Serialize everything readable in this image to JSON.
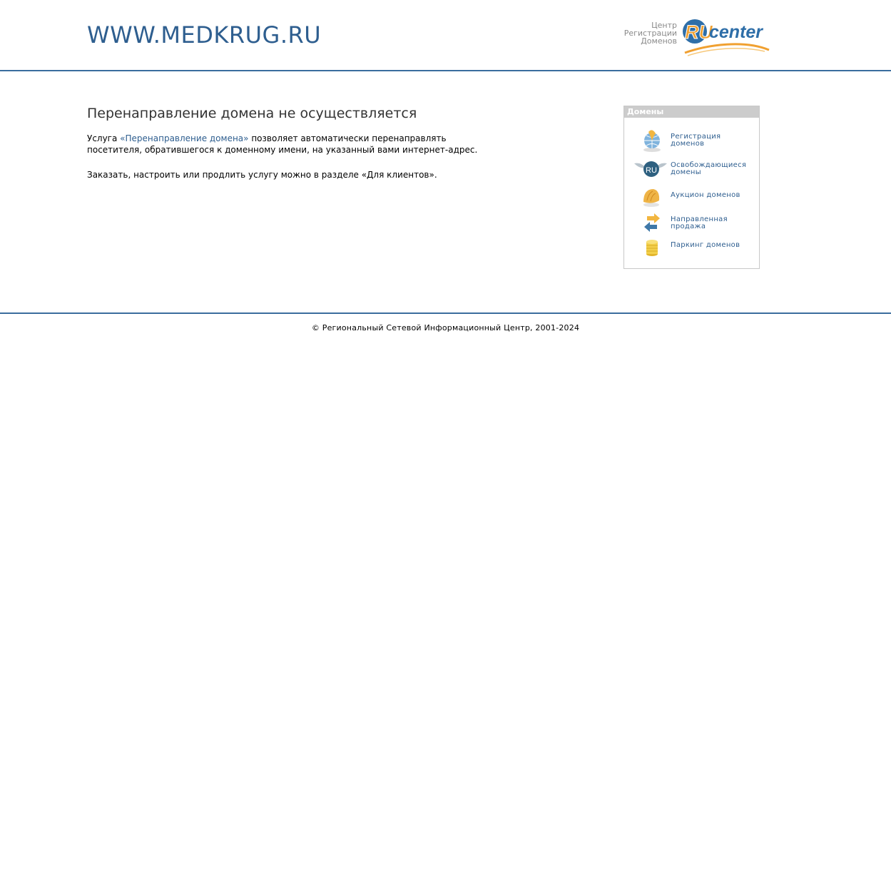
{
  "header": {
    "site_title": "WWW.MEDKRUG.RU",
    "logo_caption": [
      "Центр",
      "Регистрации",
      "Доменов"
    ],
    "logo_mark_ru": "RU",
    "logo_mark_center": "center"
  },
  "main": {
    "heading": "Перенаправление домена не осуществляется",
    "para1_prefix": "Услуга ",
    "para1_link": "«Перенаправление домена»",
    "para1_suffix": " позволяет автоматически перенаправлять посетителя, обратившегося к доменному имени, на указанный вами интернет-адрес.",
    "para2": "Заказать, настроить или продлить услугу можно в разделе «Для клиентов»."
  },
  "sidebar": {
    "title": "Домены",
    "items": [
      {
        "label": "Регистрация доменов",
        "icon": "globe-icon"
      },
      {
        "label": "Освобождающиеся домены",
        "icon": "ru-wings-icon"
      },
      {
        "label": "Аукцион доменов",
        "icon": "shell-icon"
      },
      {
        "label": "Направленная продажа",
        "icon": "arrows-icon"
      },
      {
        "label": "Паркинг доменов",
        "icon": "coins-icon"
      }
    ]
  },
  "footer": {
    "copyright": "© Региональный Сетевой Информационный Центр, 2001-2024"
  },
  "colors": {
    "accent": "#2e5e8f",
    "divider": "#3a6d9e",
    "logo_orange": "#f0a030",
    "box_header": "#cccccc"
  }
}
